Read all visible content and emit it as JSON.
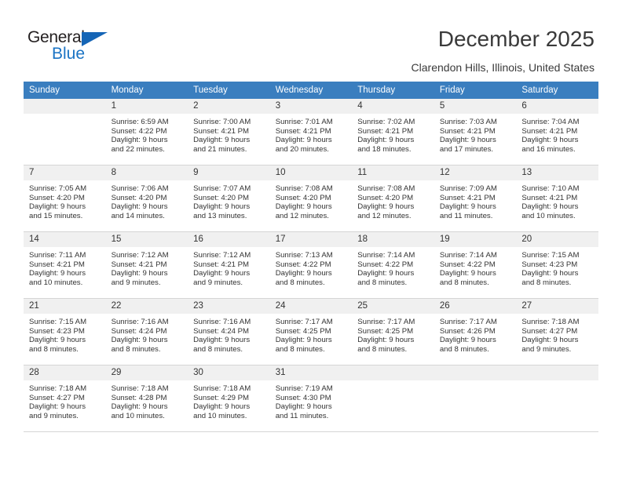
{
  "brand": {
    "name_top": "General",
    "name_bottom": "Blue",
    "triangle_icon": "blue-triangle-icon",
    "accent_color": "#1a73c4"
  },
  "header": {
    "title": "December 2025",
    "subtitle": "Clarendon Hills, Illinois, United States"
  },
  "calendar": {
    "header_bg": "#3a7ebf",
    "daynum_bg": "#f0f0f0",
    "weekdays": [
      "Sunday",
      "Monday",
      "Tuesday",
      "Wednesday",
      "Thursday",
      "Friday",
      "Saturday"
    ],
    "weeks": [
      [
        {
          "day": "",
          "lines": []
        },
        {
          "day": "1",
          "lines": [
            "Sunrise: 6:59 AM",
            "Sunset: 4:22 PM",
            "Daylight: 9 hours",
            "and 22 minutes."
          ]
        },
        {
          "day": "2",
          "lines": [
            "Sunrise: 7:00 AM",
            "Sunset: 4:21 PM",
            "Daylight: 9 hours",
            "and 21 minutes."
          ]
        },
        {
          "day": "3",
          "lines": [
            "Sunrise: 7:01 AM",
            "Sunset: 4:21 PM",
            "Daylight: 9 hours",
            "and 20 minutes."
          ]
        },
        {
          "day": "4",
          "lines": [
            "Sunrise: 7:02 AM",
            "Sunset: 4:21 PM",
            "Daylight: 9 hours",
            "and 18 minutes."
          ]
        },
        {
          "day": "5",
          "lines": [
            "Sunrise: 7:03 AM",
            "Sunset: 4:21 PM",
            "Daylight: 9 hours",
            "and 17 minutes."
          ]
        },
        {
          "day": "6",
          "lines": [
            "Sunrise: 7:04 AM",
            "Sunset: 4:21 PM",
            "Daylight: 9 hours",
            "and 16 minutes."
          ]
        }
      ],
      [
        {
          "day": "7",
          "lines": [
            "Sunrise: 7:05 AM",
            "Sunset: 4:20 PM",
            "Daylight: 9 hours",
            "and 15 minutes."
          ]
        },
        {
          "day": "8",
          "lines": [
            "Sunrise: 7:06 AM",
            "Sunset: 4:20 PM",
            "Daylight: 9 hours",
            "and 14 minutes."
          ]
        },
        {
          "day": "9",
          "lines": [
            "Sunrise: 7:07 AM",
            "Sunset: 4:20 PM",
            "Daylight: 9 hours",
            "and 13 minutes."
          ]
        },
        {
          "day": "10",
          "lines": [
            "Sunrise: 7:08 AM",
            "Sunset: 4:20 PM",
            "Daylight: 9 hours",
            "and 12 minutes."
          ]
        },
        {
          "day": "11",
          "lines": [
            "Sunrise: 7:08 AM",
            "Sunset: 4:20 PM",
            "Daylight: 9 hours",
            "and 12 minutes."
          ]
        },
        {
          "day": "12",
          "lines": [
            "Sunrise: 7:09 AM",
            "Sunset: 4:21 PM",
            "Daylight: 9 hours",
            "and 11 minutes."
          ]
        },
        {
          "day": "13",
          "lines": [
            "Sunrise: 7:10 AM",
            "Sunset: 4:21 PM",
            "Daylight: 9 hours",
            "and 10 minutes."
          ]
        }
      ],
      [
        {
          "day": "14",
          "lines": [
            "Sunrise: 7:11 AM",
            "Sunset: 4:21 PM",
            "Daylight: 9 hours",
            "and 10 minutes."
          ]
        },
        {
          "day": "15",
          "lines": [
            "Sunrise: 7:12 AM",
            "Sunset: 4:21 PM",
            "Daylight: 9 hours",
            "and 9 minutes."
          ]
        },
        {
          "day": "16",
          "lines": [
            "Sunrise: 7:12 AM",
            "Sunset: 4:21 PM",
            "Daylight: 9 hours",
            "and 9 minutes."
          ]
        },
        {
          "day": "17",
          "lines": [
            "Sunrise: 7:13 AM",
            "Sunset: 4:22 PM",
            "Daylight: 9 hours",
            "and 8 minutes."
          ]
        },
        {
          "day": "18",
          "lines": [
            "Sunrise: 7:14 AM",
            "Sunset: 4:22 PM",
            "Daylight: 9 hours",
            "and 8 minutes."
          ]
        },
        {
          "day": "19",
          "lines": [
            "Sunrise: 7:14 AM",
            "Sunset: 4:22 PM",
            "Daylight: 9 hours",
            "and 8 minutes."
          ]
        },
        {
          "day": "20",
          "lines": [
            "Sunrise: 7:15 AM",
            "Sunset: 4:23 PM",
            "Daylight: 9 hours",
            "and 8 minutes."
          ]
        }
      ],
      [
        {
          "day": "21",
          "lines": [
            "Sunrise: 7:15 AM",
            "Sunset: 4:23 PM",
            "Daylight: 9 hours",
            "and 8 minutes."
          ]
        },
        {
          "day": "22",
          "lines": [
            "Sunrise: 7:16 AM",
            "Sunset: 4:24 PM",
            "Daylight: 9 hours",
            "and 8 minutes."
          ]
        },
        {
          "day": "23",
          "lines": [
            "Sunrise: 7:16 AM",
            "Sunset: 4:24 PM",
            "Daylight: 9 hours",
            "and 8 minutes."
          ]
        },
        {
          "day": "24",
          "lines": [
            "Sunrise: 7:17 AM",
            "Sunset: 4:25 PM",
            "Daylight: 9 hours",
            "and 8 minutes."
          ]
        },
        {
          "day": "25",
          "lines": [
            "Sunrise: 7:17 AM",
            "Sunset: 4:25 PM",
            "Daylight: 9 hours",
            "and 8 minutes."
          ]
        },
        {
          "day": "26",
          "lines": [
            "Sunrise: 7:17 AM",
            "Sunset: 4:26 PM",
            "Daylight: 9 hours",
            "and 8 minutes."
          ]
        },
        {
          "day": "27",
          "lines": [
            "Sunrise: 7:18 AM",
            "Sunset: 4:27 PM",
            "Daylight: 9 hours",
            "and 9 minutes."
          ]
        }
      ],
      [
        {
          "day": "28",
          "lines": [
            "Sunrise: 7:18 AM",
            "Sunset: 4:27 PM",
            "Daylight: 9 hours",
            "and 9 minutes."
          ]
        },
        {
          "day": "29",
          "lines": [
            "Sunrise: 7:18 AM",
            "Sunset: 4:28 PM",
            "Daylight: 9 hours",
            "and 10 minutes."
          ]
        },
        {
          "day": "30",
          "lines": [
            "Sunrise: 7:18 AM",
            "Sunset: 4:29 PM",
            "Daylight: 9 hours",
            "and 10 minutes."
          ]
        },
        {
          "day": "31",
          "lines": [
            "Sunrise: 7:19 AM",
            "Sunset: 4:30 PM",
            "Daylight: 9 hours",
            "and 11 minutes."
          ]
        },
        {
          "day": "",
          "lines": []
        },
        {
          "day": "",
          "lines": []
        },
        {
          "day": "",
          "lines": []
        }
      ]
    ]
  }
}
